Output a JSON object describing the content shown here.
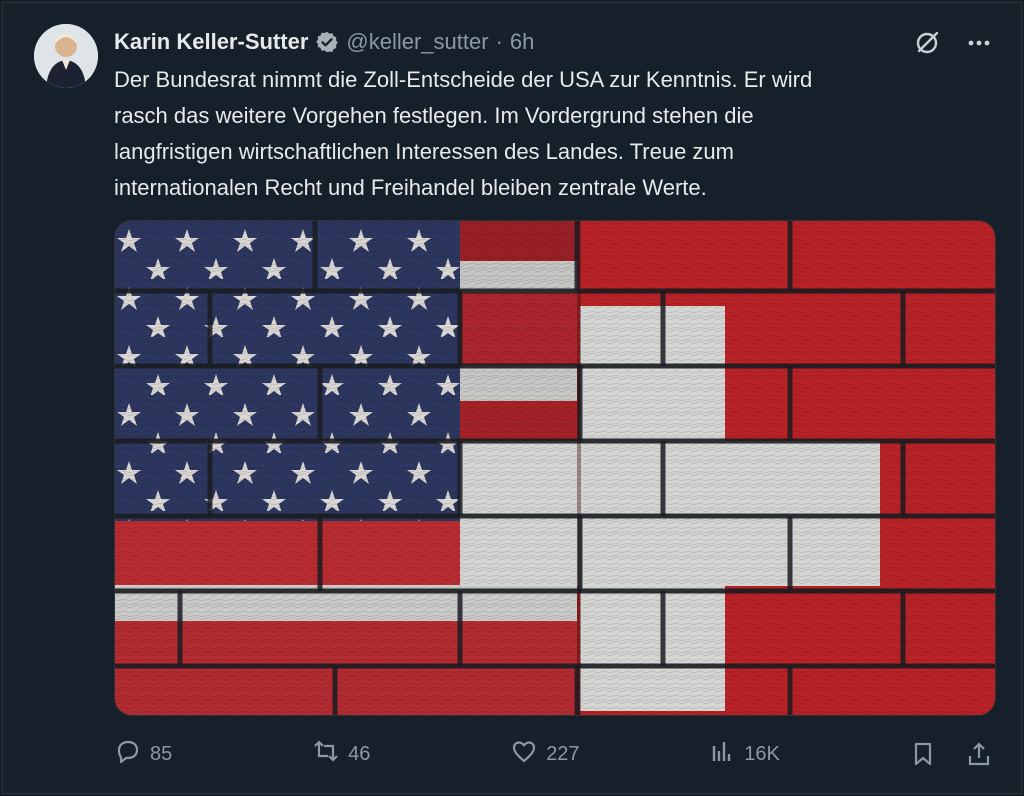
{
  "tweet": {
    "author_name": "Karin Keller-Sutter",
    "handle": "@keller_sutter",
    "separator": "·",
    "time": "6h",
    "text": "Der Bundesrat nimmt die Zoll-Entscheide der USA zur Kenntnis. Er wird\nrasch das weitere Vorgehen festlegen. Im Vordergrund stehen die\nlangfristigen wirtschaftlichen Interessen des Landes. Treue zum\ninternationalen Recht und Freihandel bleiben zentrale Werte."
  },
  "actions": {
    "reply_count": "85",
    "retweet_count": "46",
    "like_count": "227",
    "views_count": "16K"
  },
  "icons": {
    "verified": "verified-badge-icon",
    "grok": "grok-icon",
    "more": "more-icon",
    "reply": "reply-icon",
    "retweet": "retweet-icon",
    "like": "heart-icon",
    "views": "views-icon",
    "bookmark": "bookmark-icon",
    "share": "share-icon"
  },
  "colors": {
    "background": "#15202b",
    "text": "#e7e9ea",
    "muted": "#8b98a5",
    "us_blue": "#2e3a66",
    "us_red": "#b8262e",
    "swiss_red": "#c9252b",
    "white": "#e8e8e8"
  }
}
